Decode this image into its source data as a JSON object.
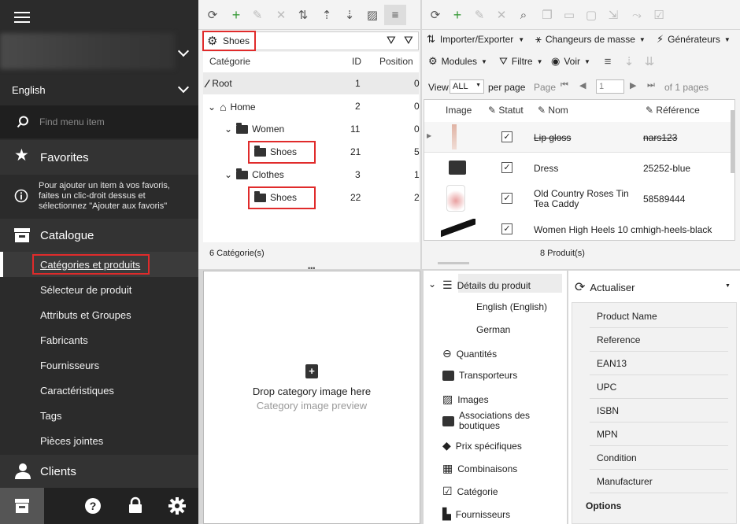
{
  "sidebar": {
    "language": "English",
    "search_placeholder": "Find menu item",
    "favorites_label": "Favorites",
    "favorites_info": "Pour ajouter un item à vos favoris, faites un clic-droit dessus et sélectionnez \"Ajouter aux favoris\"",
    "catalogue_label": "Catalogue",
    "items": [
      {
        "label": "Catégories et produits"
      },
      {
        "label": "Sélecteur de produit"
      },
      {
        "label": "Attributs et Groupes"
      },
      {
        "label": "Fabricants"
      },
      {
        "label": "Fournisseurs"
      },
      {
        "label": "Caractéristiques"
      },
      {
        "label": "Tags"
      },
      {
        "label": "Pièces jointes"
      }
    ],
    "clients_label": "Clients"
  },
  "categories": {
    "filter_value": "Shoes",
    "col_category": "Catégorie",
    "col_id": "ID",
    "col_position": "Position",
    "rows": [
      {
        "name": "Root",
        "id": "1",
        "pos": "0"
      },
      {
        "name": "Home",
        "id": "2",
        "pos": "0"
      },
      {
        "name": "Women",
        "id": "11",
        "pos": "0"
      },
      {
        "name": "Shoes",
        "id": "21",
        "pos": "5"
      },
      {
        "name": "Clothes",
        "id": "3",
        "pos": "1"
      },
      {
        "name": "Shoes",
        "id": "22",
        "pos": "2"
      }
    ],
    "count": "6 Catégorie(s)"
  },
  "image_drop": {
    "title": "Drop category image here",
    "subtitle": "Category image preview"
  },
  "products": {
    "menu": {
      "import_export": "Importer/Exporter",
      "mass": "Changeurs de masse",
      "generators": "Générateurs",
      "modules": "Modules",
      "filter": "Filtre",
      "view": "Voir"
    },
    "view_label": "View",
    "view_value": "ALL",
    "per_page": "per page",
    "page_label": "Page",
    "page_value": "1",
    "of_pages": "of 1 pages",
    "col_image": "Image",
    "col_status": "Statut",
    "col_name": "Nom",
    "col_ref": "Référence",
    "rows": [
      {
        "name": "Lip gloss",
        "ref": "nars123"
      },
      {
        "name": "Dress",
        "ref": "25252-blue"
      },
      {
        "name": "Old Country Roses Tin Tea Caddy",
        "ref": "58589444"
      },
      {
        "name": "Women High Heels 10 cm",
        "ref": "high-heels-black"
      }
    ],
    "count": "8 Produit(s)"
  },
  "details": {
    "root": "Détails du produit",
    "langs": [
      "English (English)",
      "German"
    ],
    "items": [
      "Quantités",
      "Transporteurs",
      "Images",
      "Associations des boutiques",
      "Prix spécifiques",
      "Combinaisons",
      "Catégorie",
      "Fournisseurs"
    ]
  },
  "props": {
    "refresh": "Actualiser",
    "fields": [
      "Product Name",
      "Reference",
      "EAN13",
      "UPC",
      "ISBN",
      "MPN",
      "Condition",
      "Manufacturer"
    ],
    "options": "Options"
  }
}
